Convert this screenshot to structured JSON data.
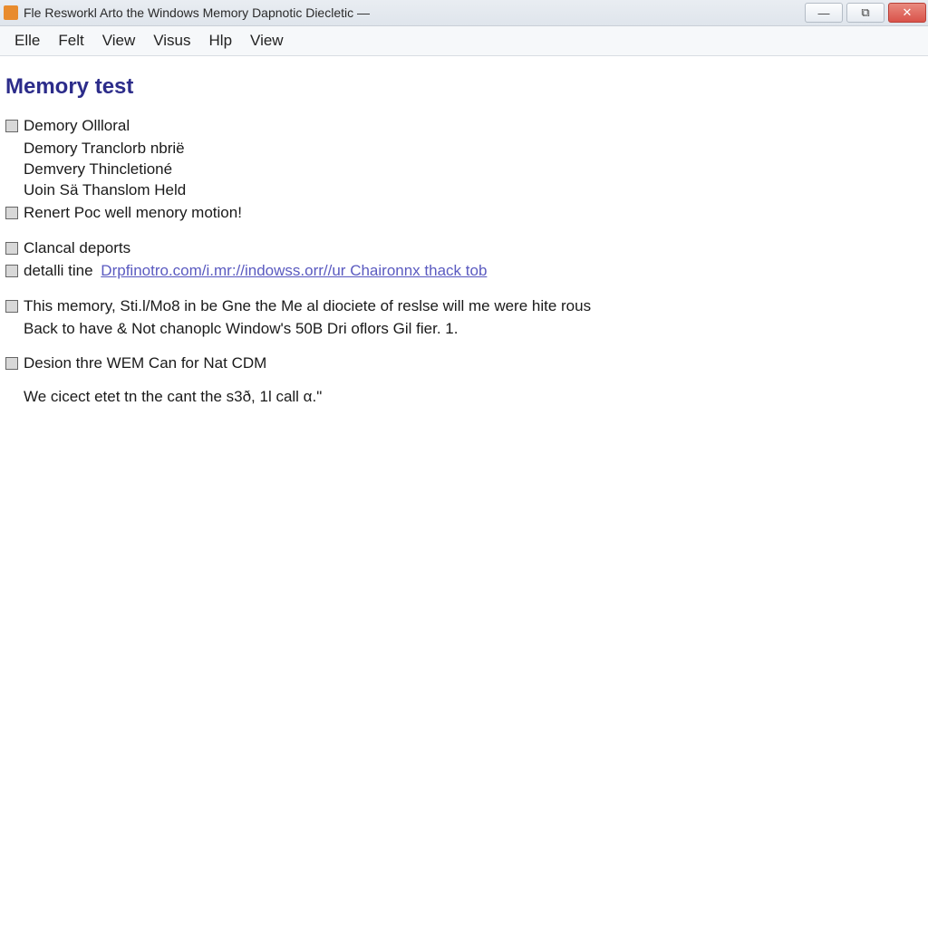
{
  "titlebar": {
    "title": "Fle Resworkl Arto the Windows Memory Dapnotic Diecletic —"
  },
  "window_controls": {
    "minimize_glyph": "—",
    "maximize_glyph": "⧉",
    "close_glyph": "✕"
  },
  "menubar": {
    "items": [
      "Elle",
      "Felt",
      "View",
      "Visus",
      "Hlp",
      "View"
    ]
  },
  "page": {
    "heading": "Memory test"
  },
  "section1": {
    "line1": "Demory Ollloral",
    "line2": "Demory Tranclorb nbrië",
    "line3": "Demvery Thincletioné",
    "line4": "Uoin Sä Thanslom Held",
    "line5": "Renert Poc well menory motion!"
  },
  "section2": {
    "line1": "Clancal deports",
    "detail_label": "detalli tine",
    "link_text": "Drpfinotro.com/i.mr://indowss.orr//ur Chaironnx thack tob"
  },
  "section3": {
    "line1": "This memory, Sti.l/Mo8 in be Gne the Me al diociete of reslse will me were hite rous",
    "line2": "Back to have & Not chanoplc Window's 50B Dri oflors Gil fier. 1."
  },
  "section4": {
    "line1": "Desion thre WEM Can for Nat CDM",
    "line2": "We cicect etet tn the cant the s3ð, 1l call α.\""
  }
}
